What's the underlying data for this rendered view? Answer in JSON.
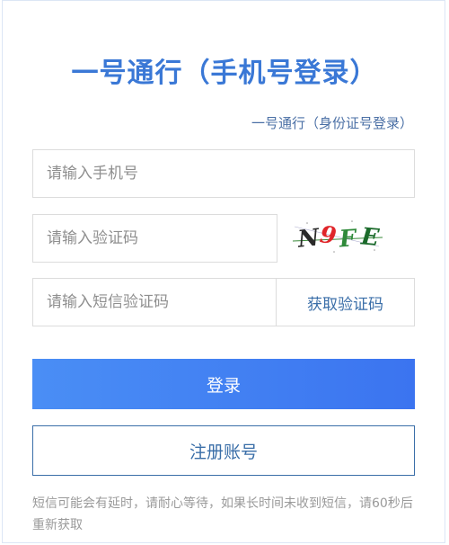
{
  "page": {
    "title": "一号通行（手机号登录）",
    "alt_login_link": "一号通行（身份证号登录）"
  },
  "form": {
    "phone_placeholder": "请输入手机号",
    "verify_placeholder": "请输入验证码",
    "captcha_text": "N9FE",
    "sms_placeholder": "请输入短信验证码",
    "get_sms_code_label": "获取验证码",
    "login_label": "登录",
    "register_label": "注册账号"
  },
  "notice": {
    "text": "短信可能会有延时，请耐心等待，如果长时间未收到短信，请60秒后重新获取"
  },
  "colors": {
    "accent": "#3a78d6",
    "button_gradient_start": "#4a8ef5",
    "button_gradient_end": "#3b74f0",
    "link": "#3a6ea8"
  }
}
